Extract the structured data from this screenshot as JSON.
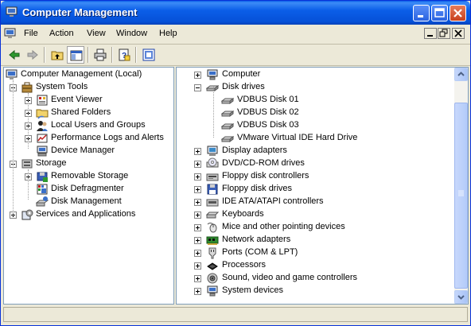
{
  "window": {
    "title": "Computer Management"
  },
  "menu": {
    "items": [
      "File",
      "Action",
      "View",
      "Window",
      "Help"
    ]
  },
  "toolbar": {
    "icons": [
      "back-icon",
      "forward-icon",
      "up-folder-icon",
      "show-tree-icon",
      "print-icon",
      "help-icon",
      "properties-icon"
    ]
  },
  "left_tree": [
    {
      "label": "Computer Management (Local)",
      "level": 0,
      "expander": "none"
    },
    {
      "label": "System Tools",
      "level": 1,
      "expander": "minus"
    },
    {
      "label": "Event Viewer",
      "level": 2,
      "expander": "plus"
    },
    {
      "label": "Shared Folders",
      "level": 2,
      "expander": "plus"
    },
    {
      "label": "Local Users and Groups",
      "level": 2,
      "expander": "plus"
    },
    {
      "label": "Performance Logs and Alerts",
      "level": 2,
      "expander": "plus"
    },
    {
      "label": "Device Manager",
      "level": 2,
      "expander": "none"
    },
    {
      "label": "Storage",
      "level": 1,
      "expander": "minus"
    },
    {
      "label": "Removable Storage",
      "level": 2,
      "expander": "plus"
    },
    {
      "label": "Disk Defragmenter",
      "level": 2,
      "expander": "none"
    },
    {
      "label": "Disk Management",
      "level": 2,
      "expander": "none"
    },
    {
      "label": "Services and Applications",
      "level": 1,
      "expander": "plus"
    }
  ],
  "right_tree": [
    {
      "label": "Computer",
      "level": 0,
      "expander": "plus",
      "icon": "computer-icon"
    },
    {
      "label": "Disk drives",
      "level": 0,
      "expander": "minus",
      "icon": "disk-drive-icon"
    },
    {
      "label": "VDBUS Disk 01",
      "level": 1,
      "expander": "none",
      "icon": "disk-drive-icon"
    },
    {
      "label": "VDBUS Disk 02",
      "level": 1,
      "expander": "none",
      "icon": "disk-drive-icon"
    },
    {
      "label": "VDBUS Disk 03",
      "level": 1,
      "expander": "none",
      "icon": "disk-drive-icon"
    },
    {
      "label": "VMware Virtual IDE Hard Drive",
      "level": 1,
      "expander": "none",
      "icon": "disk-drive-icon"
    },
    {
      "label": "Display adapters",
      "level": 0,
      "expander": "plus",
      "icon": "display-adapter-icon"
    },
    {
      "label": "DVD/CD-ROM drives",
      "level": 0,
      "expander": "plus",
      "icon": "cdrom-icon"
    },
    {
      "label": "Floppy disk controllers",
      "level": 0,
      "expander": "plus",
      "icon": "floppy-controller-icon"
    },
    {
      "label": "Floppy disk drives",
      "level": 0,
      "expander": "plus",
      "icon": "floppy-drive-icon"
    },
    {
      "label": "IDE ATA/ATAPI controllers",
      "level": 0,
      "expander": "plus",
      "icon": "ide-controller-icon"
    },
    {
      "label": "Keyboards",
      "level": 0,
      "expander": "plus",
      "icon": "keyboard-icon"
    },
    {
      "label": "Mice and other pointing devices",
      "level": 0,
      "expander": "plus",
      "icon": "mouse-icon"
    },
    {
      "label": "Network adapters",
      "level": 0,
      "expander": "plus",
      "icon": "network-adapter-icon"
    },
    {
      "label": "Ports (COM & LPT)",
      "level": 0,
      "expander": "plus",
      "icon": "port-icon"
    },
    {
      "label": "Processors",
      "level": 0,
      "expander": "plus",
      "icon": "processor-icon"
    },
    {
      "label": "Sound, video and game controllers",
      "level": 0,
      "expander": "plus",
      "icon": "sound-icon"
    },
    {
      "label": "System devices",
      "level": 0,
      "expander": "plus",
      "icon": "system-device-icon"
    }
  ],
  "colors": {
    "titlebar": "#0b5ee8",
    "close_button": "#c8401c",
    "scrollbar": "#b3cbf9",
    "pane_border": "#7f9db9"
  }
}
